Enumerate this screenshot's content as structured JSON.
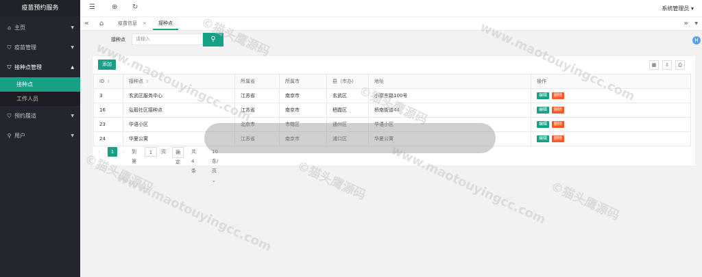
{
  "app": {
    "title": "疫苗预约服务",
    "user": "系统管理员"
  },
  "sidebar": {
    "items": [
      {
        "label": "主页",
        "icon": "home-icon"
      },
      {
        "label": "疫苗管理",
        "icon": "shield-icon"
      },
      {
        "label": "接种点管理",
        "icon": "shield-icon"
      },
      {
        "label": "预约履适",
        "icon": "shield-icon"
      },
      {
        "label": "用户",
        "icon": "user-icon"
      }
    ],
    "sub_items": [
      {
        "label": "接种点"
      },
      {
        "label": "工作人员"
      }
    ]
  },
  "tabs": [
    {
      "label": "疫苗信息"
    },
    {
      "label": "接种点"
    }
  ],
  "search": {
    "label": "接种点",
    "placeholder": "请输入"
  },
  "toolbar": {
    "add_label": "添加"
  },
  "table": {
    "columns": [
      "ID",
      "接种点",
      "所属省",
      "所属市",
      "县（市办）",
      "地址",
      "操作"
    ],
    "rows": [
      {
        "id": "3",
        "name": "玄武区服务中心",
        "province": "江苏省",
        "city": "南京市",
        "county": "玄武区",
        "address": "小寨东路100号"
      },
      {
        "id": "16",
        "name": "弘毅社区接种点",
        "province": "江苏省",
        "city": "南京市",
        "county": "栖霞区",
        "address": "桥南街道44"
      },
      {
        "id": "23",
        "name": "华语小区",
        "province": "北京市",
        "city": "市辖区",
        "county": "通州区",
        "address": "华语小区"
      },
      {
        "id": "24",
        "name": "华夏公寓",
        "province": "江苏省",
        "city": "南京市",
        "county": "浦口区",
        "address": "华夏公寓"
      }
    ],
    "edit_label": "编辑",
    "delete_label": "删除"
  },
  "pager": {
    "current": "1",
    "goto": "到第",
    "page_input": "1",
    "page_unit": "页",
    "confirm": "确定",
    "total": "共 4 条",
    "per_page": "10 条/页"
  },
  "watermark": {
    "text1": "©猫头鹰源码",
    "text2": "www.maotouyingcc.com"
  }
}
